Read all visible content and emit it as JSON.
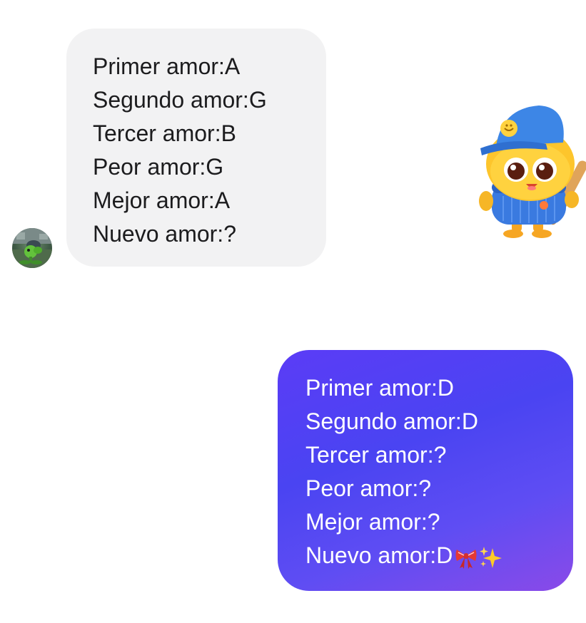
{
  "received_message": {
    "lines": [
      "Primer amor:A",
      "Segundo amor:G",
      "Tercer amor:B",
      "Peor amor:G",
      "Mejor amor:A",
      "Nuevo amor:?"
    ]
  },
  "sent_message": {
    "lines": [
      "Primer amor:D",
      "Segundo amor:D",
      "Tercer amor:?",
      "Peor amor:?",
      "Mejor amor:?",
      "Nuevo amor:D"
    ],
    "trailing_emojis": [
      "ribbon-emoji",
      "sparkles-emoji"
    ]
  },
  "colors": {
    "received_bubble": "#f2f2f3",
    "sent_bubble_start": "#5b3cf6",
    "sent_bubble_end": "#8a4ae8",
    "text_dark": "#1c1c1e",
    "text_light": "#ffffff"
  },
  "sticker": {
    "icon": "baseball-mascot-sticker"
  },
  "avatar": {
    "icon": "peashooter-avatar"
  }
}
